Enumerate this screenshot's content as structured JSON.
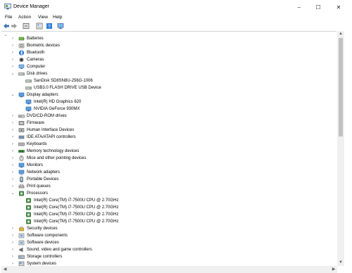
{
  "window": {
    "title": "Device Manager",
    "minimize": "–",
    "maximize": "☐",
    "close": "✕"
  },
  "menu": [
    "File",
    "Action",
    "View",
    "Help"
  ],
  "colors": {
    "title_bg": "#ffffff",
    "select": "#cce8ff",
    "accent": "#2f7ed8",
    "chip": "#3a8a3a"
  },
  "icons": {
    "back": "arrow-left-icon",
    "forward": "arrow-right-icon",
    "properties": "properties-icon",
    "help": "help-icon",
    "monitor": "monitor-icon"
  },
  "scroll": {
    "up": "▲",
    "down": "▼",
    "left": "◀",
    "right": "▶"
  },
  "tree": [
    {
      "label": "Batteries",
      "level": 1,
      "expanded": false,
      "icon": "battery"
    },
    {
      "label": "Biometric devices",
      "level": 1,
      "expanded": false,
      "icon": "biometric"
    },
    {
      "label": "Bluetooth",
      "level": 1,
      "expanded": false,
      "icon": "bluetooth"
    },
    {
      "label": "Cameras",
      "level": 1,
      "expanded": false,
      "icon": "camera"
    },
    {
      "label": "Computer",
      "level": 1,
      "expanded": false,
      "icon": "computer"
    },
    {
      "label": "Disk drives",
      "level": 1,
      "expanded": true,
      "icon": "disk"
    },
    {
      "label": "SanDisk SD8SN8U-256G-1006",
      "level": 2,
      "icon": "disk"
    },
    {
      "label": "USB3.0 FLASH DRIVE USB Device",
      "level": 2,
      "icon": "disk"
    },
    {
      "label": "Display adapters",
      "level": 1,
      "expanded": true,
      "icon": "display"
    },
    {
      "label": "Intel(R) HD Graphics 620",
      "level": 2,
      "icon": "display"
    },
    {
      "label": "NVIDIA GeForce 930MX",
      "level": 2,
      "icon": "display"
    },
    {
      "label": "DVD/CD-ROM drives",
      "level": 1,
      "expanded": false,
      "icon": "dvd"
    },
    {
      "label": "Firmware",
      "level": 1,
      "expanded": false,
      "icon": "firmware"
    },
    {
      "label": "Human Interface Devices",
      "level": 1,
      "expanded": false,
      "icon": "hid"
    },
    {
      "label": "IDE ATA/ATAPI controllers",
      "level": 1,
      "expanded": false,
      "icon": "ide"
    },
    {
      "label": "Keyboards",
      "level": 1,
      "expanded": false,
      "icon": "keyboard"
    },
    {
      "label": "Memory technology devices",
      "level": 1,
      "expanded": false,
      "icon": "memory"
    },
    {
      "label": "Mice and other pointing devices",
      "level": 1,
      "expanded": false,
      "icon": "mouse"
    },
    {
      "label": "Monitors",
      "level": 1,
      "expanded": false,
      "icon": "monitor"
    },
    {
      "label": "Network adapters",
      "level": 1,
      "expanded": false,
      "icon": "network"
    },
    {
      "label": "Portable Devices",
      "level": 1,
      "expanded": false,
      "icon": "portable"
    },
    {
      "label": "Print queues",
      "level": 1,
      "expanded": false,
      "icon": "printer"
    },
    {
      "label": "Processors",
      "level": 1,
      "expanded": true,
      "icon": "chip"
    },
    {
      "label": "Intel(R) Core(TM) i7-7500U CPU @ 2.70GHz",
      "level": 2,
      "icon": "chip"
    },
    {
      "label": "Intel(R) Core(TM) i7-7500U CPU @ 2.70GHz",
      "level": 2,
      "icon": "chip"
    },
    {
      "label": "Intel(R) Core(TM) i7-7500U CPU @ 2.70GHz",
      "level": 2,
      "icon": "chip"
    },
    {
      "label": "Intel(R) Core(TM) i7-7500U CPU @ 2.70GHz",
      "level": 2,
      "icon": "chip"
    },
    {
      "label": "Security devices",
      "level": 1,
      "expanded": false,
      "icon": "security"
    },
    {
      "label": "Software components",
      "level": 1,
      "expanded": false,
      "icon": "software"
    },
    {
      "label": "Software devices",
      "level": 1,
      "expanded": false,
      "icon": "software"
    },
    {
      "label": "Sound, video and game controllers",
      "level": 1,
      "expanded": false,
      "icon": "sound"
    },
    {
      "label": "Storage controllers",
      "level": 1,
      "expanded": false,
      "icon": "storage"
    },
    {
      "label": "System devices",
      "level": 1,
      "expanded": false,
      "icon": "system"
    }
  ]
}
